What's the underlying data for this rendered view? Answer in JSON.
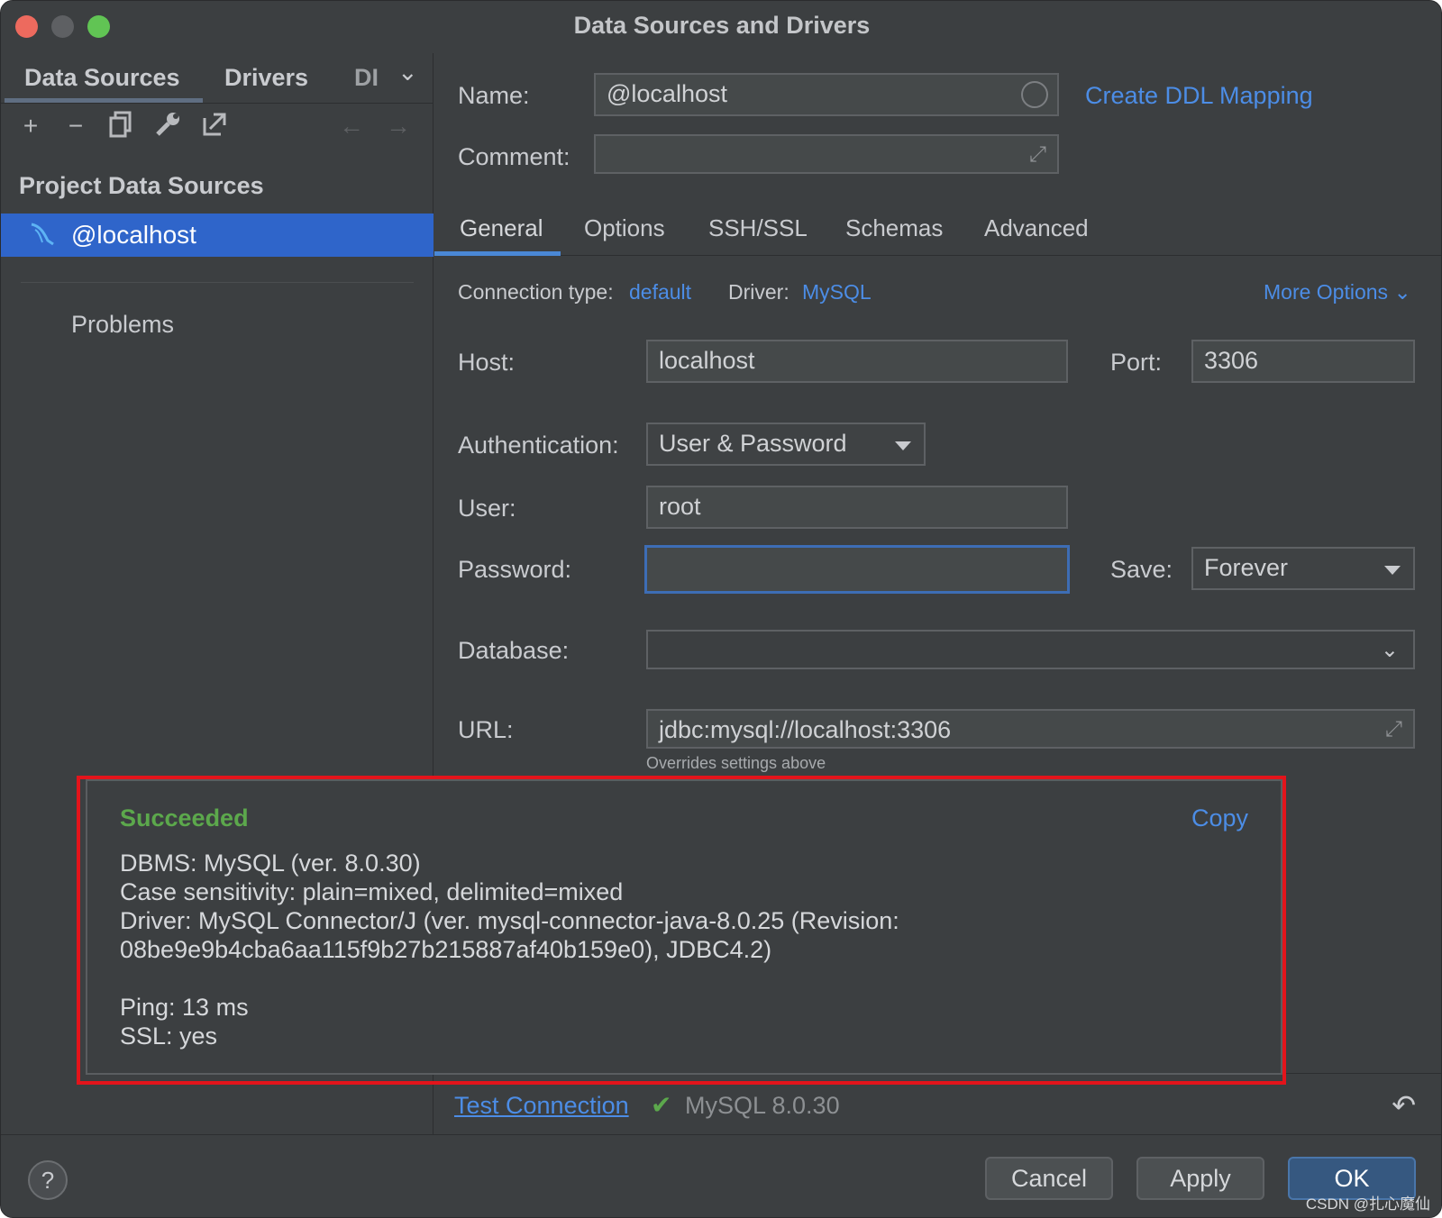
{
  "window": {
    "title": "Data Sources and Drivers"
  },
  "left": {
    "tabs": [
      "Data Sources",
      "Drivers",
      "DI"
    ],
    "section_title": "Project Data Sources",
    "datasource": "@localhost",
    "problems": "Problems"
  },
  "form": {
    "name_label": "Name:",
    "name_value": "@localhost",
    "create_ddl": "Create DDL Mapping",
    "comment_label": "Comment:",
    "comment_value": "",
    "tabs": [
      "General",
      "Options",
      "SSH/SSL",
      "Schemas",
      "Advanced"
    ],
    "connection_type_label": "Connection type:",
    "connection_type_value": "default",
    "driver_label": "Driver:",
    "driver_value": "MySQL",
    "more_options": "More Options",
    "host_label": "Host:",
    "host_value": "localhost",
    "port_label": "Port:",
    "port_value": "3306",
    "auth_label": "Authentication:",
    "auth_value": "User & Password",
    "user_label": "User:",
    "user_value": "root",
    "password_label": "Password:",
    "password_value": "",
    "save_label": "Save:",
    "save_value": "Forever",
    "database_label": "Database:",
    "database_value": "",
    "url_label": "URL:",
    "url_value": "jdbc:mysql://localhost:3306",
    "url_hint": "Overrides settings above"
  },
  "popup": {
    "status": "Succeeded",
    "copy": "Copy",
    "lines": [
      "DBMS: MySQL (ver. 8.0.30)",
      "Case sensitivity: plain=mixed, delimited=mixed",
      "Driver: MySQL Connector/J (ver. mysql-connector-java-8.0.25 (Revision:",
      "08be9e9b4cba6aa115f9b27b215887af40b159e0), JDBC4.2)",
      "Ping: 13 ms",
      "SSL: yes"
    ]
  },
  "test": {
    "link": "Test Connection",
    "version": "MySQL 8.0.30"
  },
  "footer": {
    "help": "?",
    "cancel": "Cancel",
    "apply": "Apply",
    "ok": "OK",
    "watermark": "CSDN @扎心魔仙"
  },
  "colors": {
    "accent": "#4c8de6",
    "selection": "#2f65ca",
    "success": "#5ca84c",
    "highlight_frame": "#e3141b"
  }
}
